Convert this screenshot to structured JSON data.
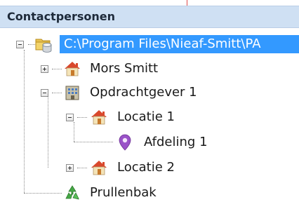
{
  "panel": {
    "title": "Contactpersonen"
  },
  "tree": {
    "root": {
      "label": "C:\\Program Files\\Nieaf-Smitt\\PA",
      "icon": "database-folder-icon",
      "expanded": true,
      "selected": true
    },
    "items": [
      {
        "label": "Mors Smitt",
        "icon": "house-icon",
        "expanded": false
      },
      {
        "label": "Opdrachtgever 1",
        "icon": "building-icon",
        "expanded": true
      },
      {
        "label": "Locatie 1",
        "icon": "house-icon",
        "expanded": true
      },
      {
        "label": "Afdeling 1",
        "icon": "location-pin-icon"
      },
      {
        "label": "Locatie 2",
        "icon": "house-icon",
        "expanded": false
      },
      {
        "label": "Prullenbak",
        "icon": "recycle-bin-icon"
      }
    ]
  },
  "colors": {
    "header_bg": "#cfe0f3",
    "selection": "#3399ff",
    "house_roof": "#d9482c",
    "pin": "#9a52c8",
    "recycle": "#45a845"
  }
}
